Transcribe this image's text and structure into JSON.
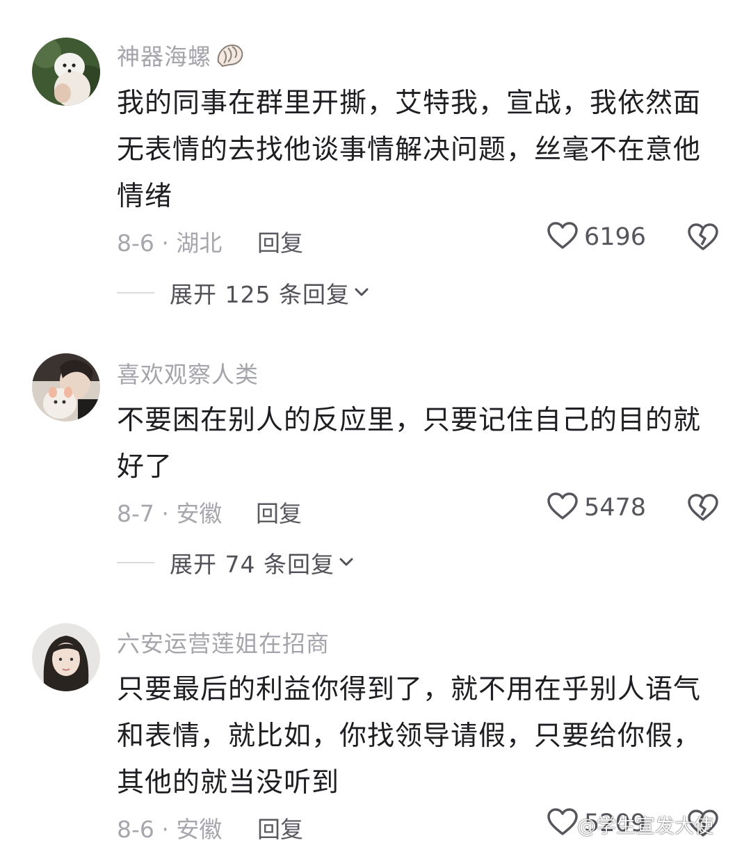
{
  "comments": [
    {
      "username": "神器海螺",
      "lines": [
        "我的同事在群里开撕，艾特我，宣战，我依然面",
        "无表情的去找他谈事情解决问题，丝毫不在意他",
        "情绪"
      ],
      "date_location": "8-6 · 湖北",
      "reply_label": "回复",
      "likes": "6196",
      "expand_label": "展开 125 条回复"
    },
    {
      "username": "喜欢观察人类",
      "lines": [
        "不要困在别人的反应里，只要记住自己的目的就",
        "好了"
      ],
      "date_location": "8-7 · 安徽",
      "reply_label": "回复",
      "likes": "5478",
      "expand_label": "展开 74 条回复"
    },
    {
      "username": "六安运营莲姐在招商",
      "lines": [
        "只要最后的利益你得到了，就不用在乎别人语气",
        "和表情，就比如，你找领导请假，只要给你假，",
        "其他的就当没听到"
      ],
      "date_location": "8-6 · 安徽",
      "reply_label": "回复",
      "likes": "5209"
    }
  ],
  "watermark": "@学生宣发大使",
  "icons": {
    "like": "heart-outline-icon",
    "dislike": "broken-heart-icon",
    "expand": "chevron-down-icon",
    "name_emoji": "conch-shell-icon"
  },
  "colors": {
    "username": "#a4a4ab",
    "text": "#1e1e22",
    "meta": "#a6a6ad",
    "action": "#595960"
  }
}
